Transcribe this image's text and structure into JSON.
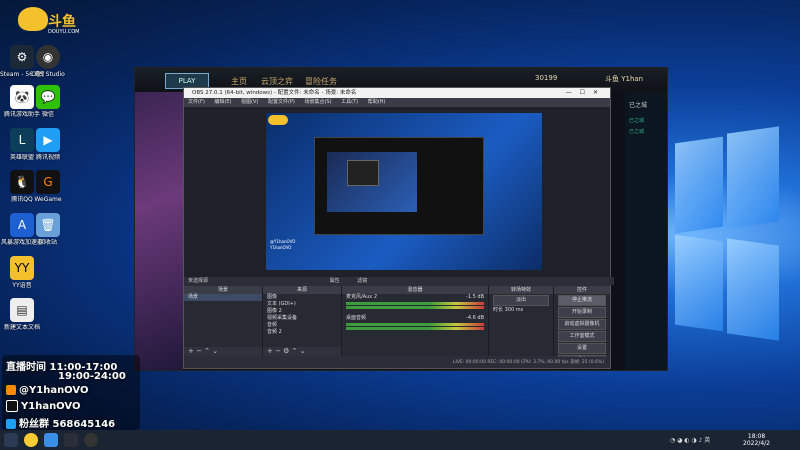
{
  "desktop": {
    "logo": {
      "name": "斗鱼",
      "sub": "DOUYU.COM"
    },
    "icons_left": [
      {
        "label": "Steam - 56 理性式",
        "color": "#1b2838"
      },
      {
        "label": "腾讯游戏助手",
        "color": "#1f8ae0"
      },
      {
        "label": "英雄联盟",
        "color": "#0d3e59"
      },
      {
        "label": "腾讯QQ",
        "color": "#111"
      },
      {
        "label": "风暴游戏加速器",
        "color": "#1e5fd1"
      },
      {
        "label": "YY语音",
        "color": "#f4c12c"
      },
      {
        "label": "新建文本文档",
        "color": "#eee"
      }
    ],
    "icons_right": [
      {
        "label": "OBS Studio",
        "color": "#333"
      },
      {
        "label": "微信",
        "color": "#2dc100"
      },
      {
        "label": "腾讯视频",
        "color": "#1e9ef4"
      },
      {
        "label": "WeGame",
        "color": "#111"
      },
      {
        "label": "回收站",
        "color": "#6aa0d8"
      }
    ],
    "recycle_label": "回收站"
  },
  "lol": {
    "play_label": "PLAY",
    "nav": [
      "主页",
      "云顶之弈",
      "冒险任务"
    ],
    "currency": "30199",
    "player_name": "斗鱼 Y1han",
    "side_text": [
      "已之城",
      "已之城",
      "已之城"
    ]
  },
  "obs": {
    "title": "OBS 27.0.1 (64-bit, windows) - 配置文件: 未命名 - 场景: 未命名",
    "menu": [
      "文件(F)",
      "编辑(E)",
      "视图(V)",
      "配置文件(P)",
      "场景集合(S)",
      "工具(T)",
      "帮助(H)"
    ],
    "scene_bar_label": "未选择源",
    "scene_bar_buttons": [
      "属性",
      "滤镜"
    ],
    "docks": {
      "scenes": {
        "title": "场景",
        "items": [
          "场景"
        ]
      },
      "sources": {
        "title": "来源",
        "items": [
          "图像",
          "文本 (GDI+)",
          "图像 2",
          "视频采集设备",
          "音频",
          "音频 2"
        ]
      },
      "mixer": {
        "title": "混音器",
        "tracks": [
          {
            "name": "麦克风/Aux 2",
            "db": "-1.5 dB"
          },
          {
            "name": "桌面音频",
            "db": "-4.6 dB"
          }
        ]
      },
      "transitions": {
        "title": "转场特效",
        "type": "淡出",
        "duration_label": "时长",
        "duration": "300 ms"
      },
      "controls": {
        "title": "控件",
        "buttons": [
          "停止推流",
          "开始录制",
          "启动虚拟摄像机",
          "工作室模式",
          "设置",
          "退出"
        ]
      }
    },
    "status": "LIVE: 00:00:00   REC: 00:00:00   CPU: 3.7%, 60.00 fps   丢帧: 25 (0.6%)"
  },
  "overlay": {
    "schedule_label": "直播时间",
    "time1": "11:00-17:00",
    "time2": "19:00-24:00",
    "platform1": "@Y1hanOVO",
    "platform2": "Y1hanOVO",
    "fans_label": "粉丝群",
    "fans_group": "568645146"
  },
  "taskbar": {
    "time": "18:08",
    "date": "2022/4/2"
  }
}
